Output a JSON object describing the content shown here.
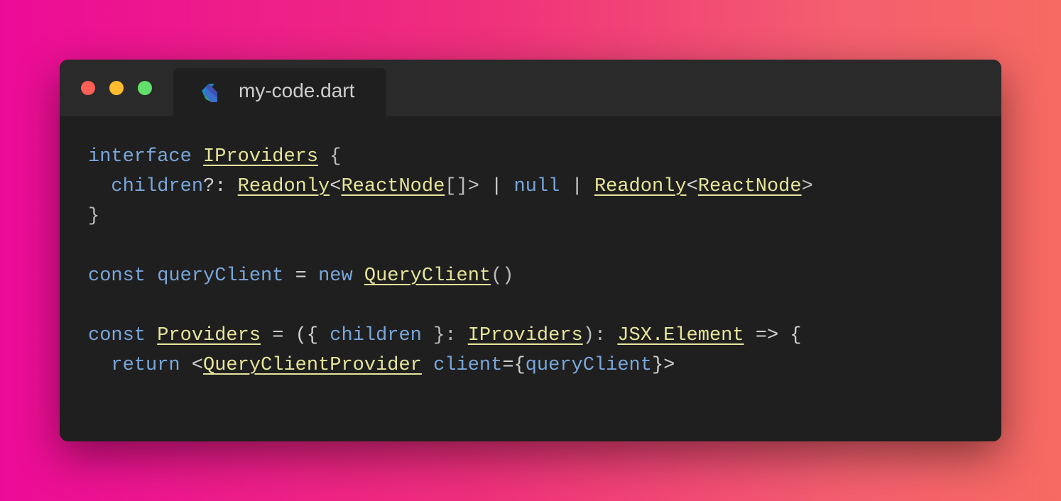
{
  "window": {
    "tab_title": "my-code.dart",
    "tab_icon": "dart-icon",
    "controls": [
      "close",
      "minimize",
      "maximize"
    ]
  },
  "colors": {
    "keyword": "#7aa6da",
    "type": "#e6e59a",
    "punctuation": "#bdbdbd",
    "editor_bg": "#1f1f1f",
    "titlebar_bg": "#2a2a2a"
  },
  "code": {
    "lines": [
      [
        {
          "t": "interface",
          "c": "kw"
        },
        {
          "t": " ",
          "c": "op"
        },
        {
          "t": "IProviders",
          "c": "ty"
        },
        {
          "t": " {",
          "c": "pn"
        }
      ],
      [
        {
          "t": "  ",
          "c": "op"
        },
        {
          "t": "children",
          "c": "id"
        },
        {
          "t": "?: ",
          "c": "op"
        },
        {
          "t": "Readonly",
          "c": "ty"
        },
        {
          "t": "<",
          "c": "op"
        },
        {
          "t": "ReactNode",
          "c": "ty"
        },
        {
          "t": "[]> ",
          "c": "pn"
        },
        {
          "t": "|",
          "c": "op"
        },
        {
          "t": " ",
          "c": "op"
        },
        {
          "t": "null",
          "c": "kw"
        },
        {
          "t": " ",
          "c": "op"
        },
        {
          "t": "|",
          "c": "op"
        },
        {
          "t": " ",
          "c": "op"
        },
        {
          "t": "Readonly",
          "c": "ty"
        },
        {
          "t": "<",
          "c": "op"
        },
        {
          "t": "ReactNode",
          "c": "ty"
        },
        {
          "t": ">",
          "c": "pn"
        }
      ],
      [
        {
          "t": "}",
          "c": "pn"
        }
      ],
      [],
      [
        {
          "t": "const",
          "c": "kw"
        },
        {
          "t": " ",
          "c": "op"
        },
        {
          "t": "queryClient",
          "c": "id"
        },
        {
          "t": " = ",
          "c": "op"
        },
        {
          "t": "new",
          "c": "kw"
        },
        {
          "t": " ",
          "c": "op"
        },
        {
          "t": "QueryClient",
          "c": "ty"
        },
        {
          "t": "()",
          "c": "pn"
        }
      ],
      [],
      [
        {
          "t": "const",
          "c": "kw"
        },
        {
          "t": " ",
          "c": "op"
        },
        {
          "t": "Providers",
          "c": "ty"
        },
        {
          "t": " = ({ ",
          "c": "op"
        },
        {
          "t": "children",
          "c": "id"
        },
        {
          "t": " }: ",
          "c": "pn"
        },
        {
          "t": "IProviders",
          "c": "ty"
        },
        {
          "t": "): ",
          "c": "pn"
        },
        {
          "t": "JSX.Element",
          "c": "ty"
        },
        {
          "t": " => {",
          "c": "op"
        }
      ],
      [
        {
          "t": "  ",
          "c": "op"
        },
        {
          "t": "return",
          "c": "kw"
        },
        {
          "t": " <",
          "c": "op"
        },
        {
          "t": "QueryClientProvider",
          "c": "ty"
        },
        {
          "t": " ",
          "c": "op"
        },
        {
          "t": "client",
          "c": "id"
        },
        {
          "t": "={",
          "c": "op"
        },
        {
          "t": "queryClient",
          "c": "id"
        },
        {
          "t": "}>",
          "c": "op"
        }
      ]
    ]
  }
}
